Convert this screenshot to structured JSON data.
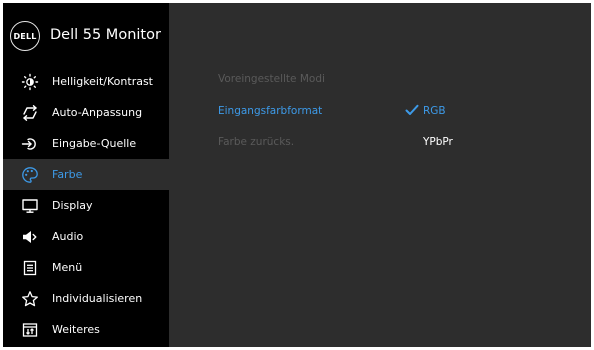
{
  "header": {
    "logo_text": "DELL",
    "title": "Dell 55 Monitor"
  },
  "menu": {
    "items": [
      {
        "label": "Helligkeit/Kontrast",
        "icon": "brightness-icon"
      },
      {
        "label": "Auto-Anpassung",
        "icon": "auto-adjust-icon"
      },
      {
        "label": "Eingabe-Quelle",
        "icon": "input-source-icon"
      },
      {
        "label": "Farbe",
        "icon": "color-palette-icon",
        "selected": true
      },
      {
        "label": "Display",
        "icon": "display-icon"
      },
      {
        "label": "Audio",
        "icon": "speaker-icon"
      },
      {
        "label": "Menü",
        "icon": "menu-icon"
      },
      {
        "label": "Individualisieren",
        "icon": "star-icon"
      },
      {
        "label": "Weiteres",
        "icon": "others-icon"
      }
    ]
  },
  "settings": {
    "preset_modes": {
      "label": "Voreingestellte Modi"
    },
    "input_color_format": {
      "label": "Eingangsfarbformat",
      "options": [
        "RGB",
        "YPbPr"
      ],
      "selected": "RGB"
    },
    "reset_color": {
      "label": "Farbe zurücks."
    }
  },
  "colors": {
    "accent": "#3d9ae8",
    "sidebar": "#000000",
    "panel": "#2d2d2d",
    "disabled_text": "#5a5a5a",
    "text": "#ffffff"
  }
}
